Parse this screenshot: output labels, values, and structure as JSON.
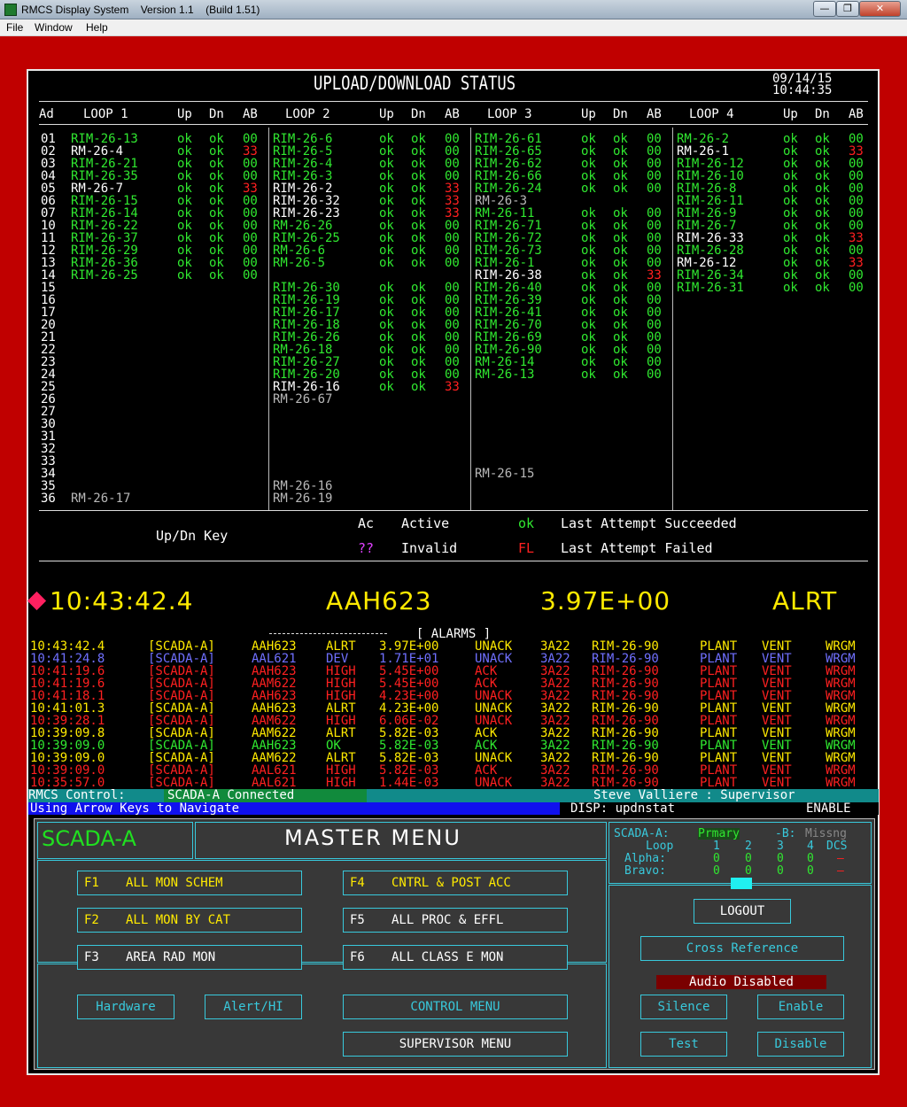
{
  "window": {
    "title": "RMCS Display System    Version 1.1    (Build 1.51)",
    "min": "—",
    "max": "❐",
    "close": "✕"
  },
  "menubar": {
    "items": [
      "File",
      "Window",
      "Help"
    ]
  },
  "status": {
    "title": "UPLOAD/DOWNLOAD STATUS",
    "date": "09/14/15",
    "time": "10:44:35"
  },
  "colors": {
    "green": "#30e830",
    "white": "#ffffff",
    "gray": "#b8b8b8",
    "red": "#ff2020",
    "yellow": "#ffea00",
    "purple": "#7070ff",
    "cyan": "#38c9dc"
  },
  "headers": {
    "ad": "Ad",
    "loops": [
      "LOOP 1",
      "LOOP 2",
      "LOOP 3",
      "LOOP 4"
    ],
    "up": "Up",
    "dn": "Dn",
    "ab": "AB"
  },
  "addresses": [
    "01",
    "02",
    "03",
    "04",
    "05",
    "06",
    "07",
    "10",
    "11",
    "12",
    "13",
    "14",
    "15",
    "16",
    "17",
    "20",
    "21",
    "22",
    "23",
    "24",
    "25",
    "26",
    "27",
    "30",
    "31",
    "32",
    "33",
    "34",
    "35",
    "36"
  ],
  "loops": [
    [
      {
        "r": 0,
        "n": "RIM-26-13",
        "u": "ok",
        "d": "ok",
        "a": "00",
        "c": "g"
      },
      {
        "r": 1,
        "n": "RM-26-4",
        "u": "ok",
        "d": "ok",
        "a": "33",
        "c": "w"
      },
      {
        "r": 2,
        "n": "RIM-26-21",
        "u": "ok",
        "d": "ok",
        "a": "00",
        "c": "g"
      },
      {
        "r": 3,
        "n": "RIM-26-35",
        "u": "ok",
        "d": "ok",
        "a": "00",
        "c": "g"
      },
      {
        "r": 4,
        "n": "RM-26-7",
        "u": "ok",
        "d": "ok",
        "a": "33",
        "c": "w"
      },
      {
        "r": 5,
        "n": "RIM-26-15",
        "u": "ok",
        "d": "ok",
        "a": "00",
        "c": "g"
      },
      {
        "r": 6,
        "n": "RIM-26-14",
        "u": "ok",
        "d": "ok",
        "a": "00",
        "c": "g"
      },
      {
        "r": 7,
        "n": "RIM-26-22",
        "u": "ok",
        "d": "ok",
        "a": "00",
        "c": "g"
      },
      {
        "r": 8,
        "n": "RIM-26-37",
        "u": "ok",
        "d": "ok",
        "a": "00",
        "c": "g"
      },
      {
        "r": 9,
        "n": "RIM-26-29",
        "u": "ok",
        "d": "ok",
        "a": "00",
        "c": "g"
      },
      {
        "r": 10,
        "n": "RIM-26-36",
        "u": "ok",
        "d": "ok",
        "a": "00",
        "c": "g"
      },
      {
        "r": 11,
        "n": "RIM-26-25",
        "u": "ok",
        "d": "ok",
        "a": "00",
        "c": "g"
      },
      {
        "r": 29,
        "n": "RM-26-17",
        "u": "",
        "d": "",
        "a": "",
        "c": "gr"
      }
    ],
    [
      {
        "r": 0,
        "n": "RIM-26-6",
        "u": "ok",
        "d": "ok",
        "a": "00",
        "c": "g"
      },
      {
        "r": 1,
        "n": "RIM-26-5",
        "u": "ok",
        "d": "ok",
        "a": "00",
        "c": "g"
      },
      {
        "r": 2,
        "n": "RIM-26-4",
        "u": "ok",
        "d": "ok",
        "a": "00",
        "c": "g"
      },
      {
        "r": 3,
        "n": "RIM-26-3",
        "u": "ok",
        "d": "ok",
        "a": "00",
        "c": "g"
      },
      {
        "r": 4,
        "n": "RIM-26-2",
        "u": "ok",
        "d": "ok",
        "a": "33",
        "c": "w"
      },
      {
        "r": 5,
        "n": "RIM-26-32",
        "u": "ok",
        "d": "ok",
        "a": "33",
        "c": "w"
      },
      {
        "r": 6,
        "n": "RIM-26-23",
        "u": "ok",
        "d": "ok",
        "a": "33",
        "c": "w"
      },
      {
        "r": 7,
        "n": "RM-26-26",
        "u": "ok",
        "d": "ok",
        "a": "00",
        "c": "g"
      },
      {
        "r": 8,
        "n": "RIM-26-25",
        "u": "ok",
        "d": "ok",
        "a": "00",
        "c": "g"
      },
      {
        "r": 9,
        "n": "RM-26-6",
        "u": "ok",
        "d": "ok",
        "a": "00",
        "c": "g"
      },
      {
        "r": 10,
        "n": "RM-26-5",
        "u": "ok",
        "d": "ok",
        "a": "00",
        "c": "g"
      },
      {
        "r": 12,
        "n": "RIM-26-30",
        "u": "ok",
        "d": "ok",
        "a": "00",
        "c": "g"
      },
      {
        "r": 13,
        "n": "RIM-26-19",
        "u": "ok",
        "d": "ok",
        "a": "00",
        "c": "g"
      },
      {
        "r": 14,
        "n": "RIM-26-17",
        "u": "ok",
        "d": "ok",
        "a": "00",
        "c": "g"
      },
      {
        "r": 15,
        "n": "RIM-26-18",
        "u": "ok",
        "d": "ok",
        "a": "00",
        "c": "g"
      },
      {
        "r": 16,
        "n": "RIM-26-26",
        "u": "ok",
        "d": "ok",
        "a": "00",
        "c": "g"
      },
      {
        "r": 17,
        "n": "RM-26-18",
        "u": "ok",
        "d": "ok",
        "a": "00",
        "c": "g"
      },
      {
        "r": 18,
        "n": "RIM-26-27",
        "u": "ok",
        "d": "ok",
        "a": "00",
        "c": "g"
      },
      {
        "r": 19,
        "n": "RIM-26-20",
        "u": "ok",
        "d": "ok",
        "a": "00",
        "c": "g"
      },
      {
        "r": 20,
        "n": "RIM-26-16",
        "u": "ok",
        "d": "ok",
        "a": "33",
        "c": "w"
      },
      {
        "r": 21,
        "n": "RM-26-67",
        "u": "",
        "d": "",
        "a": "",
        "c": "gr"
      },
      {
        "r": 28,
        "n": "RM-26-16",
        "u": "",
        "d": "",
        "a": "",
        "c": "gr"
      },
      {
        "r": 29,
        "n": "RM-26-19",
        "u": "",
        "d": "",
        "a": "",
        "c": "gr"
      }
    ],
    [
      {
        "r": 0,
        "n": "RIM-26-61",
        "u": "ok",
        "d": "ok",
        "a": "00",
        "c": "g"
      },
      {
        "r": 1,
        "n": "RIM-26-65",
        "u": "ok",
        "d": "ok",
        "a": "00",
        "c": "g"
      },
      {
        "r": 2,
        "n": "RIM-26-62",
        "u": "ok",
        "d": "ok",
        "a": "00",
        "c": "g"
      },
      {
        "r": 3,
        "n": "RIM-26-66",
        "u": "ok",
        "d": "ok",
        "a": "00",
        "c": "g"
      },
      {
        "r": 4,
        "n": "RIM-26-24",
        "u": "ok",
        "d": "ok",
        "a": "00",
        "c": "g"
      },
      {
        "r": 5,
        "n": "RM-26-3",
        "u": "",
        "d": "",
        "a": "",
        "c": "gr"
      },
      {
        "r": 6,
        "n": "RM-26-11",
        "u": "ok",
        "d": "ok",
        "a": "00",
        "c": "g"
      },
      {
        "r": 7,
        "n": "RIM-26-71",
        "u": "ok",
        "d": "ok",
        "a": "00",
        "c": "g"
      },
      {
        "r": 8,
        "n": "RIM-26-72",
        "u": "ok",
        "d": "ok",
        "a": "00",
        "c": "g"
      },
      {
        "r": 9,
        "n": "RIM-26-73",
        "u": "ok",
        "d": "ok",
        "a": "00",
        "c": "g"
      },
      {
        "r": 10,
        "n": "RIM-26-1",
        "u": "ok",
        "d": "ok",
        "a": "00",
        "c": "g"
      },
      {
        "r": 11,
        "n": "RIM-26-38",
        "u": "ok",
        "d": "ok",
        "a": "33",
        "c": "w"
      },
      {
        "r": 12,
        "n": "RIM-26-40",
        "u": "ok",
        "d": "ok",
        "a": "00",
        "c": "g"
      },
      {
        "r": 13,
        "n": "RIM-26-39",
        "u": "ok",
        "d": "ok",
        "a": "00",
        "c": "g"
      },
      {
        "r": 14,
        "n": "RIM-26-41",
        "u": "ok",
        "d": "ok",
        "a": "00",
        "c": "g"
      },
      {
        "r": 15,
        "n": "RIM-26-70",
        "u": "ok",
        "d": "ok",
        "a": "00",
        "c": "g"
      },
      {
        "r": 16,
        "n": "RIM-26-69",
        "u": "ok",
        "d": "ok",
        "a": "00",
        "c": "g"
      },
      {
        "r": 17,
        "n": "RIM-26-90",
        "u": "ok",
        "d": "ok",
        "a": "00",
        "c": "g"
      },
      {
        "r": 18,
        "n": "RM-26-14",
        "u": "ok",
        "d": "ok",
        "a": "00",
        "c": "g"
      },
      {
        "r": 19,
        "n": "RM-26-13",
        "u": "ok",
        "d": "ok",
        "a": "00",
        "c": "g"
      },
      {
        "r": 27,
        "n": "RM-26-15",
        "u": "",
        "d": "",
        "a": "",
        "c": "gr"
      }
    ],
    [
      {
        "r": 0,
        "n": "RM-26-2",
        "u": "ok",
        "d": "ok",
        "a": "00",
        "c": "g"
      },
      {
        "r": 1,
        "n": "RM-26-1",
        "u": "ok",
        "d": "ok",
        "a": "33",
        "c": "w"
      },
      {
        "r": 2,
        "n": "RIM-26-12",
        "u": "ok",
        "d": "ok",
        "a": "00",
        "c": "g"
      },
      {
        "r": 3,
        "n": "RIM-26-10",
        "u": "ok",
        "d": "ok",
        "a": "00",
        "c": "g"
      },
      {
        "r": 4,
        "n": "RIM-26-8",
        "u": "ok",
        "d": "ok",
        "a": "00",
        "c": "g"
      },
      {
        "r": 5,
        "n": "RIM-26-11",
        "u": "ok",
        "d": "ok",
        "a": "00",
        "c": "g"
      },
      {
        "r": 6,
        "n": "RIM-26-9",
        "u": "ok",
        "d": "ok",
        "a": "00",
        "c": "g"
      },
      {
        "r": 7,
        "n": "RIM-26-7",
        "u": "ok",
        "d": "ok",
        "a": "00",
        "c": "g"
      },
      {
        "r": 8,
        "n": "RIM-26-33",
        "u": "ok",
        "d": "ok",
        "a": "33",
        "c": "w"
      },
      {
        "r": 9,
        "n": "RIM-26-28",
        "u": "ok",
        "d": "ok",
        "a": "00",
        "c": "g"
      },
      {
        "r": 10,
        "n": "RM-26-12",
        "u": "ok",
        "d": "ok",
        "a": "33",
        "c": "w"
      },
      {
        "r": 11,
        "n": "RIM-26-34",
        "u": "ok",
        "d": "ok",
        "a": "00",
        "c": "g"
      },
      {
        "r": 12,
        "n": "RIM-26-31",
        "u": "ok",
        "d": "ok",
        "a": "00",
        "c": "g"
      }
    ]
  ],
  "key": {
    "title": "Up/Dn Key",
    "ac": "Ac",
    "active": "Active",
    "ok": "ok",
    "succeeded": "Last Attempt Succeeded",
    "invalid_code": "??",
    "invalid": "Invalid",
    "fl": "FL",
    "failed": "Last Attempt Failed"
  },
  "current_alarm": {
    "time": "10:43:42.4",
    "point": "AAH623",
    "value": "3.97E+00",
    "state": "ALRT"
  },
  "alarms_header": "[ ALARMS ]",
  "alarms": [
    {
      "t": "10:43:42.4",
      "s": "[SCADA-A]",
      "p": "AAH623",
      "st": "ALRT",
      "v": "3.97E+00",
      "ack": "UNACK",
      "loc": "3A22",
      "rim": "RIM-26-90",
      "a": "PLANT",
      "b": "VENT",
      "c": "WRGM",
      "col": "y"
    },
    {
      "t": "10:41:24.8",
      "s": "[SCADA-A]",
      "p": "AAL621",
      "st": "DEV",
      "v": "1.71E+01",
      "ack": "UNACK",
      "loc": "3A22",
      "rim": "RIM-26-90",
      "a": "PLANT",
      "b": "VENT",
      "c": "WRGM",
      "col": "p"
    },
    {
      "t": "10:41:19.6",
      "s": "[SCADA-A]",
      "p": "AAH623",
      "st": "HIGH",
      "v": "5.45E+00",
      "ack": "ACK",
      "loc": "3A22",
      "rim": "RIM-26-90",
      "a": "PLANT",
      "b": "VENT",
      "c": "WRGM",
      "col": "r"
    },
    {
      "t": "10:41:19.6",
      "s": "[SCADA-A]",
      "p": "AAM622",
      "st": "HIGH",
      "v": "5.45E+00",
      "ack": "ACK",
      "loc": "3A22",
      "rim": "RIM-26-90",
      "a": "PLANT",
      "b": "VENT",
      "c": "WRGM",
      "col": "r"
    },
    {
      "t": "10:41:18.1",
      "s": "[SCADA-A]",
      "p": "AAH623",
      "st": "HIGH",
      "v": "4.23E+00",
      "ack": "UNACK",
      "loc": "3A22",
      "rim": "RIM-26-90",
      "a": "PLANT",
      "b": "VENT",
      "c": "WRGM",
      "col": "r"
    },
    {
      "t": "10:41:01.3",
      "s": "[SCADA-A]",
      "p": "AAH623",
      "st": "ALRT",
      "v": "4.23E+00",
      "ack": "UNACK",
      "loc": "3A22",
      "rim": "RIM-26-90",
      "a": "PLANT",
      "b": "VENT",
      "c": "WRGM",
      "col": "y"
    },
    {
      "t": "10:39:28.1",
      "s": "[SCADA-A]",
      "p": "AAM622",
      "st": "HIGH",
      "v": "6.06E-02",
      "ack": "UNACK",
      "loc": "3A22",
      "rim": "RIM-26-90",
      "a": "PLANT",
      "b": "VENT",
      "c": "WRGM",
      "col": "r"
    },
    {
      "t": "10:39:09.8",
      "s": "[SCADA-A]",
      "p": "AAM622",
      "st": "ALRT",
      "v": "5.82E-03",
      "ack": "ACK",
      "loc": "3A22",
      "rim": "RIM-26-90",
      "a": "PLANT",
      "b": "VENT",
      "c": "WRGM",
      "col": "y"
    },
    {
      "t": "10:39:09.0",
      "s": "[SCADA-A]",
      "p": "AAH623",
      "st": "OK",
      "v": "5.82E-03",
      "ack": "ACK",
      "loc": "3A22",
      "rim": "RIM-26-90",
      "a": "PLANT",
      "b": "VENT",
      "c": "WRGM",
      "col": "g"
    },
    {
      "t": "10:39:09.0",
      "s": "[SCADA-A]",
      "p": "AAM622",
      "st": "ALRT",
      "v": "5.82E-03",
      "ack": "UNACK",
      "loc": "3A22",
      "rim": "RIM-26-90",
      "a": "PLANT",
      "b": "VENT",
      "c": "WRGM",
      "col": "y"
    },
    {
      "t": "10:39:09.0",
      "s": "[SCADA-A]",
      "p": "AAL621",
      "st": "HIGH",
      "v": "5.82E-03",
      "ack": "ACK",
      "loc": "3A22",
      "rim": "RIM-26-90",
      "a": "PLANT",
      "b": "VENT",
      "c": "WRGM",
      "col": "r"
    },
    {
      "t": "10:35:57.0",
      "s": "[SCADA-A]",
      "p": "AAL621",
      "st": "HIGH",
      "v": "1.44E-03",
      "ack": "UNACK",
      "loc": "3A22",
      "rim": "RIM-26-90",
      "a": "PLANT",
      "b": "VENT",
      "c": "WRGM",
      "col": "r"
    }
  ],
  "control": {
    "label": "RMCS Control:",
    "status": "SCADA-A Connected",
    "user": "Steve Valliere : Supervisor"
  },
  "nav": {
    "hint": "Using Arrow Keys to Navigate",
    "disp": "DISP: updnstat",
    "mode": "ENABLE"
  },
  "menu": {
    "scada": "SCADA-A",
    "title": "MASTER MENU",
    "f1": {
      "key": "F1",
      "label": "ALL MON SCHEM"
    },
    "f2": {
      "key": "F2",
      "label": "ALL MON BY CAT"
    },
    "f3": {
      "key": "F3",
      "label": "AREA RAD MON"
    },
    "f4": {
      "key": "F4",
      "label": "CNTRL & POST ACC"
    },
    "f5": {
      "key": "F5",
      "label": "ALL PROC & EFFL"
    },
    "f6": {
      "key": "F6",
      "label": "ALL CLASS E MON"
    },
    "hardware": "Hardware",
    "alert_hi": "Alert/HI",
    "control_menu": "CONTROL MENU",
    "supervisor_menu": "SUPERVISOR MENU",
    "logout": "LOGOUT",
    "cross_ref": "Cross Reference",
    "audio": "Audio Disabled",
    "silence": "Silence",
    "enable": "Enable",
    "test": "Test",
    "disable": "Disable"
  },
  "sysstat": {
    "a_label": "SCADA-A:",
    "a_state": "Prmary",
    "b_label": "-B:",
    "b_state": "Missng",
    "loop_label": "Loop",
    "loops": [
      "1",
      "2",
      "3",
      "4"
    ],
    "dcs": "DCS",
    "alpha": "Alpha:",
    "bravo": "Bravo:",
    "alpha_vals": [
      "0",
      "0",
      "0",
      "0"
    ],
    "bravo_vals": [
      "0",
      "0",
      "0",
      "0"
    ],
    "dash": "–"
  }
}
